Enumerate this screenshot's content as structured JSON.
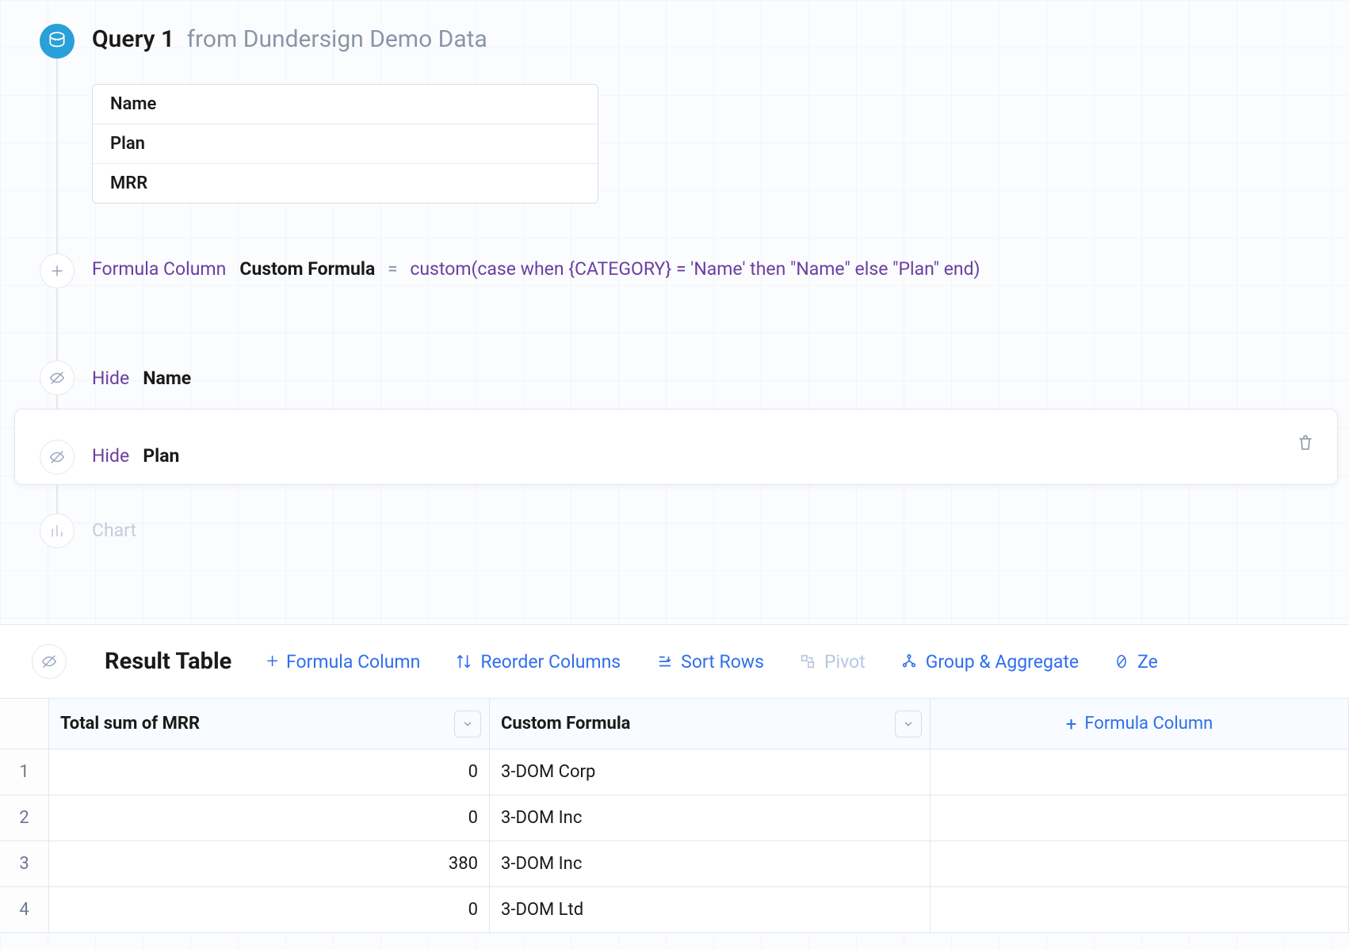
{
  "query": {
    "title": "Query 1",
    "from_prefix": "from",
    "datasource": "Dundersign Demo Data",
    "columns": [
      "Name",
      "Plan",
      "MRR"
    ]
  },
  "steps": {
    "formula": {
      "label": "Formula Column",
      "name": "Custom Formula",
      "equals": "=",
      "expression": "custom(case when {CATEGORY} = 'Name' then \"Name\" else \"Plan\" end)"
    },
    "hide1": {
      "verb": "Hide",
      "column": "Name"
    },
    "hide2": {
      "verb": "Hide",
      "column": "Plan"
    },
    "chart_label": "Chart"
  },
  "result": {
    "title": "Result Table",
    "actions": {
      "formula_column": "Formula Column",
      "reorder": "Reorder Columns",
      "sort": "Sort Rows",
      "pivot": "Pivot",
      "group": "Group & Aggregate",
      "zero": "Ze"
    },
    "columns": {
      "mrr": "Total sum of MRR",
      "custom": "Custom Formula",
      "add": "Formula Column"
    },
    "rows": [
      {
        "n": "1",
        "mrr": "0",
        "custom": "3-DOM Corp"
      },
      {
        "n": "2",
        "mrr": "0",
        "custom": "3-DOM Inc"
      },
      {
        "n": "3",
        "mrr": "380",
        "custom": "3-DOM Inc"
      },
      {
        "n": "4",
        "mrr": "0",
        "custom": "3-DOM Ltd"
      }
    ]
  },
  "icons": {
    "plus": "+",
    "chevron_down": "⌄"
  }
}
